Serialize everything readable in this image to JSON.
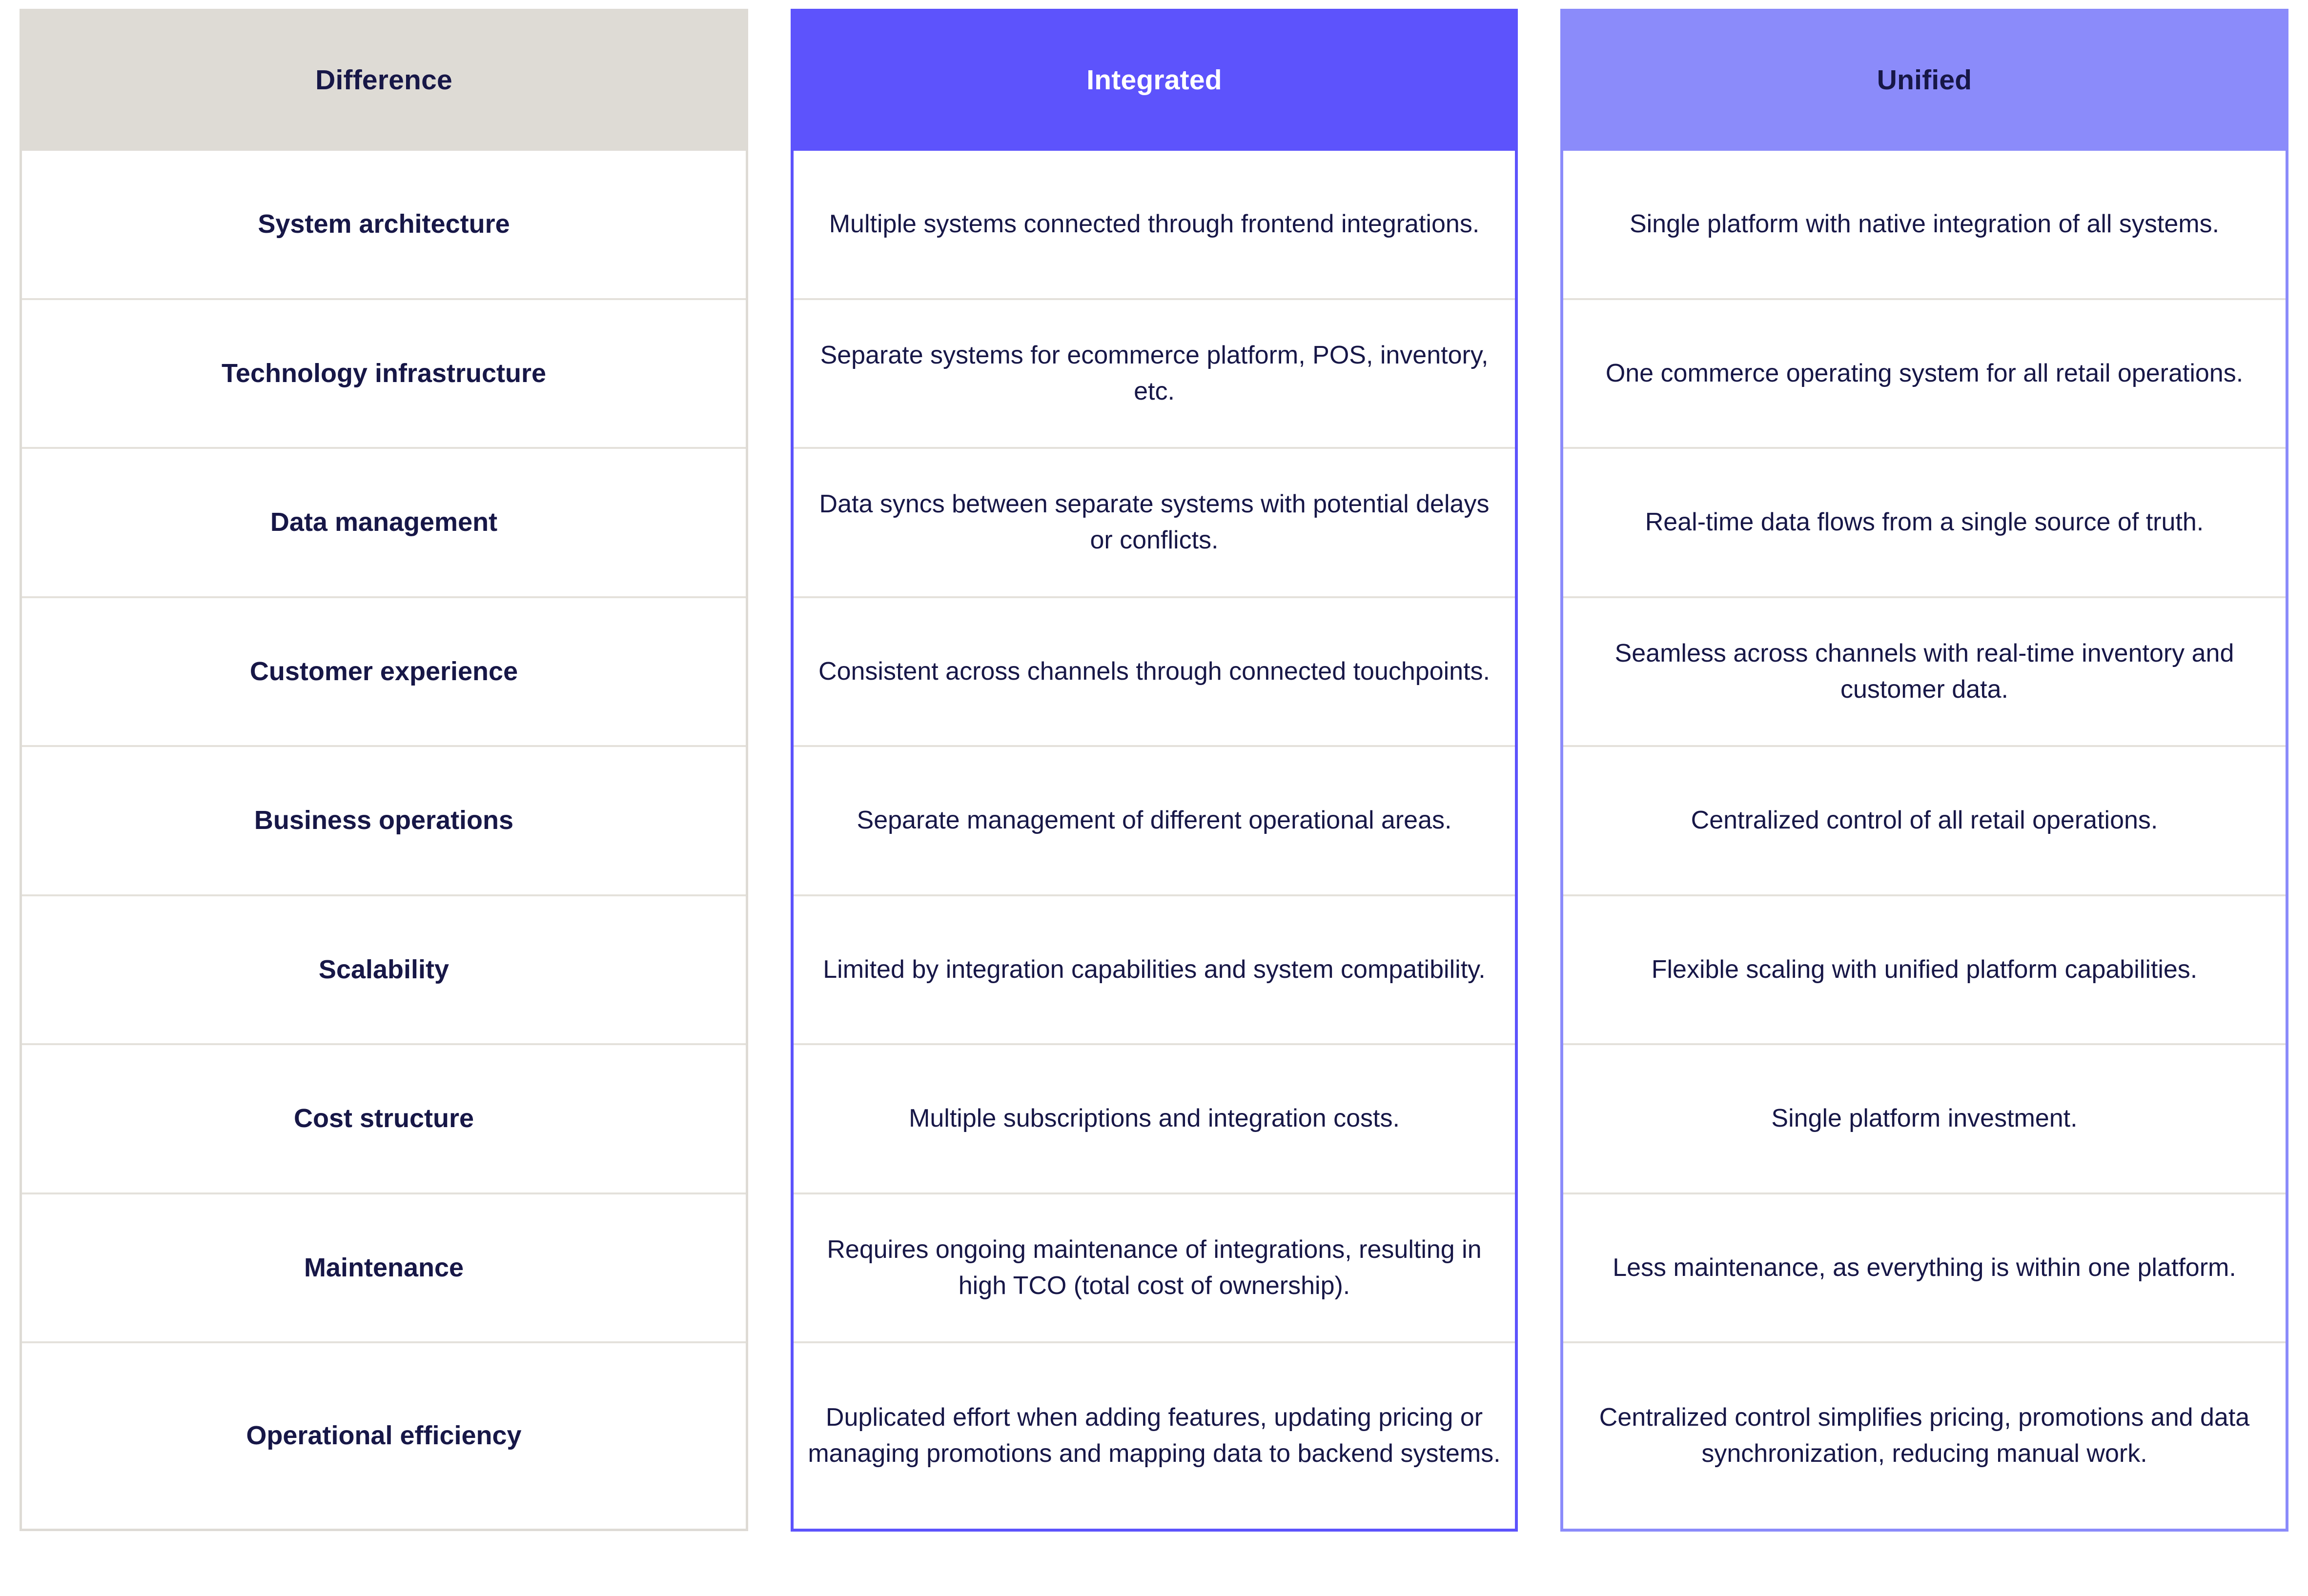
{
  "table": {
    "headers": {
      "difference": "Difference",
      "integrated": "Integrated",
      "unified": "Unified"
    },
    "colors": {
      "difference_header_bg": "#DEDBD5",
      "integrated_header_bg": "#5D53FC",
      "unified_header_bg": "#8B8BFA",
      "text_dark": "#171747",
      "text_light": "#FFFFFF",
      "row_divider": "#E4E1DB"
    },
    "rows": [
      {
        "difference": "System architecture",
        "integrated": "Multiple systems connected through frontend integrations.",
        "unified": "Single platform with native integration of all systems."
      },
      {
        "difference": "Technology infrastructure",
        "integrated": "Separate systems for ecommerce platform, POS, inventory, etc.",
        "unified": "One commerce operating system for all retail operations."
      },
      {
        "difference": "Data management",
        "integrated": "Data syncs between separate systems with potential delays or conflicts.",
        "unified": "Real-time data flows from a single source of truth."
      },
      {
        "difference": "Customer experience",
        "integrated": "Consistent across channels through connected touchpoints.",
        "unified": "Seamless across channels with real-time inventory and customer data."
      },
      {
        "difference": "Business operations",
        "integrated": "Separate management of different operational areas.",
        "unified": "Centralized control of all retail operations."
      },
      {
        "difference": "Scalability",
        "integrated": "Limited by integration capabilities and system compatibility.",
        "unified": "Flexible scaling with unified platform capabilities."
      },
      {
        "difference": "Cost structure",
        "integrated": "Multiple subscriptions and integration costs.",
        "unified": "Single platform investment."
      },
      {
        "difference": "Maintenance",
        "integrated": "Requires ongoing maintenance of integrations, resulting in high TCO (total cost of ownership).",
        "unified": "Less maintenance, as everything is within one platform."
      },
      {
        "difference": "Operational efficiency",
        "integrated": "Duplicated effort when adding features, updating pricing or managing promotions and mapping data to backend systems.",
        "unified": "Centralized control simplifies pricing, promotions and data synchronization, reducing manual work."
      }
    ]
  }
}
